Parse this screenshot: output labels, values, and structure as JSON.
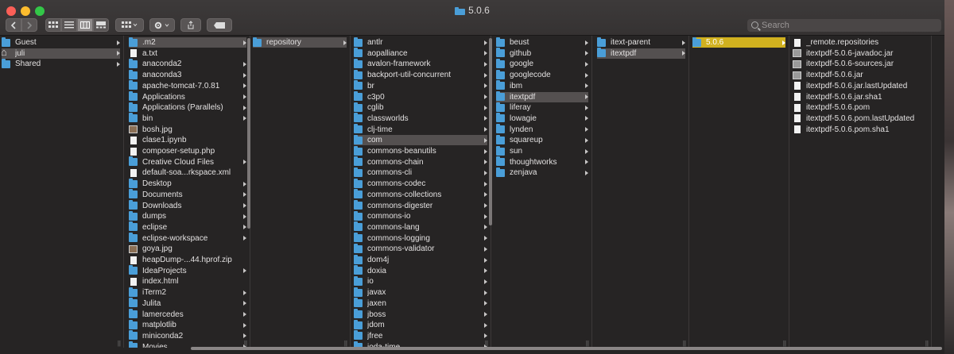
{
  "window": {
    "title": "5.0.6"
  },
  "toolbar": {
    "back_icon": "chevron-left-icon",
    "forward_icon": "chevron-right-icon",
    "view_icon_view": "grid-icon",
    "view_list": "list-icon",
    "view_columns": "columns-icon",
    "view_gallery": "gallery-icon",
    "arrange_icon": "arrange-icon",
    "action_icon": "gear-icon",
    "share_icon": "share-icon",
    "tags_icon": "tag-icon",
    "search_placeholder": "Search"
  },
  "columns": [
    {
      "items": [
        {
          "label": "Guest",
          "kind": "folder",
          "arrow": true
        },
        {
          "label": "juli",
          "kind": "home",
          "arrow": true,
          "selected": true
        },
        {
          "label": "Shared",
          "kind": "folder",
          "arrow": true
        }
      ]
    },
    {
      "items": [
        {
          "label": ".m2",
          "kind": "folder",
          "arrow": true,
          "selected": true
        },
        {
          "label": "a.txt",
          "kind": "file"
        },
        {
          "label": "anaconda2",
          "kind": "folder",
          "arrow": true
        },
        {
          "label": "anaconda3",
          "kind": "folder",
          "arrow": true
        },
        {
          "label": "apache-tomcat-7.0.81",
          "kind": "folder",
          "arrow": true
        },
        {
          "label": "Applications",
          "kind": "folder",
          "arrow": true
        },
        {
          "label": "Applications (Parallels)",
          "kind": "folder",
          "arrow": true
        },
        {
          "label": "bin",
          "kind": "folder",
          "arrow": true
        },
        {
          "label": "bosh.jpg",
          "kind": "image"
        },
        {
          "label": "clase1.ipynb",
          "kind": "file"
        },
        {
          "label": "composer-setup.php",
          "kind": "file"
        },
        {
          "label": "Creative Cloud Files",
          "kind": "folder",
          "arrow": true
        },
        {
          "label": "default-soa...rkspace.xml",
          "kind": "file"
        },
        {
          "label": "Desktop",
          "kind": "folder",
          "arrow": true
        },
        {
          "label": "Documents",
          "kind": "folder",
          "arrow": true
        },
        {
          "label": "Downloads",
          "kind": "folder",
          "arrow": true
        },
        {
          "label": "dumps",
          "kind": "folder",
          "arrow": true
        },
        {
          "label": "eclipse",
          "kind": "folder",
          "arrow": true
        },
        {
          "label": "eclipse-workspace",
          "kind": "folder",
          "arrow": true
        },
        {
          "label": "goya.jpg",
          "kind": "image"
        },
        {
          "label": "heapDump-...44.hprof.zip",
          "kind": "file"
        },
        {
          "label": "IdeaProjects",
          "kind": "folder",
          "arrow": true
        },
        {
          "label": "index.html",
          "kind": "file"
        },
        {
          "label": "iTerm2",
          "kind": "folder",
          "arrow": true
        },
        {
          "label": "Julita",
          "kind": "folder",
          "arrow": true
        },
        {
          "label": "lamercedes",
          "kind": "folder",
          "arrow": true
        },
        {
          "label": "matplotlib",
          "kind": "folder",
          "arrow": true
        },
        {
          "label": "miniconda2",
          "kind": "folder",
          "arrow": true
        },
        {
          "label": "Movies",
          "kind": "folder",
          "arrow": true
        }
      ]
    },
    {
      "items": [
        {
          "label": "repository",
          "kind": "folder",
          "arrow": true,
          "selected": true
        }
      ]
    },
    {
      "items": [
        {
          "label": "antlr",
          "kind": "folder",
          "arrow": true
        },
        {
          "label": "aopalliance",
          "kind": "folder",
          "arrow": true
        },
        {
          "label": "avalon-framework",
          "kind": "folder",
          "arrow": true
        },
        {
          "label": "backport-util-concurrent",
          "kind": "folder",
          "arrow": true
        },
        {
          "label": "br",
          "kind": "folder",
          "arrow": true
        },
        {
          "label": "c3p0",
          "kind": "folder",
          "arrow": true
        },
        {
          "label": "cglib",
          "kind": "folder",
          "arrow": true
        },
        {
          "label": "classworlds",
          "kind": "folder",
          "arrow": true
        },
        {
          "label": "clj-time",
          "kind": "folder",
          "arrow": true
        },
        {
          "label": "com",
          "kind": "folder",
          "arrow": true,
          "selected": true
        },
        {
          "label": "commons-beanutils",
          "kind": "folder",
          "arrow": true
        },
        {
          "label": "commons-chain",
          "kind": "folder",
          "arrow": true
        },
        {
          "label": "commons-cli",
          "kind": "folder",
          "arrow": true
        },
        {
          "label": "commons-codec",
          "kind": "folder",
          "arrow": true
        },
        {
          "label": "commons-collections",
          "kind": "folder",
          "arrow": true
        },
        {
          "label": "commons-digester",
          "kind": "folder",
          "arrow": true
        },
        {
          "label": "commons-io",
          "kind": "folder",
          "arrow": true
        },
        {
          "label": "commons-lang",
          "kind": "folder",
          "arrow": true
        },
        {
          "label": "commons-logging",
          "kind": "folder",
          "arrow": true
        },
        {
          "label": "commons-validator",
          "kind": "folder",
          "arrow": true
        },
        {
          "label": "dom4j",
          "kind": "folder",
          "arrow": true
        },
        {
          "label": "doxia",
          "kind": "folder",
          "arrow": true
        },
        {
          "label": "io",
          "kind": "folder",
          "arrow": true
        },
        {
          "label": "javax",
          "kind": "folder",
          "arrow": true
        },
        {
          "label": "jaxen",
          "kind": "folder",
          "arrow": true
        },
        {
          "label": "jboss",
          "kind": "folder",
          "arrow": true
        },
        {
          "label": "jdom",
          "kind": "folder",
          "arrow": true
        },
        {
          "label": "jfree",
          "kind": "folder",
          "arrow": true
        },
        {
          "label": "joda-time",
          "kind": "folder",
          "arrow": true
        }
      ]
    },
    {
      "items": [
        {
          "label": "beust",
          "kind": "folder",
          "arrow": true
        },
        {
          "label": "github",
          "kind": "folder",
          "arrow": true
        },
        {
          "label": "google",
          "kind": "folder",
          "arrow": true
        },
        {
          "label": "googlecode",
          "kind": "folder",
          "arrow": true
        },
        {
          "label": "ibm",
          "kind": "folder",
          "arrow": true
        },
        {
          "label": "itextpdf",
          "kind": "folder",
          "arrow": true,
          "selected": true
        },
        {
          "label": "liferay",
          "kind": "folder",
          "arrow": true
        },
        {
          "label": "lowagie",
          "kind": "folder",
          "arrow": true
        },
        {
          "label": "lynden",
          "kind": "folder",
          "arrow": true
        },
        {
          "label": "squareup",
          "kind": "folder",
          "arrow": true
        },
        {
          "label": "sun",
          "kind": "folder",
          "arrow": true
        },
        {
          "label": "thoughtworks",
          "kind": "folder",
          "arrow": true
        },
        {
          "label": "zenjava",
          "kind": "folder",
          "arrow": true
        }
      ]
    },
    {
      "items": [
        {
          "label": "itext-parent",
          "kind": "folder",
          "arrow": true
        },
        {
          "label": "itextpdf",
          "kind": "folder",
          "arrow": true,
          "selected": true
        }
      ]
    },
    {
      "items": [
        {
          "label": "5.0.6",
          "kind": "folder",
          "arrow": true,
          "selected": true,
          "active": true
        }
      ]
    },
    {
      "items": [
        {
          "label": "_remote.repositories",
          "kind": "file"
        },
        {
          "label": "itextpdf-5.0.6-javadoc.jar",
          "kind": "jar"
        },
        {
          "label": "itextpdf-5.0.6-sources.jar",
          "kind": "jar"
        },
        {
          "label": "itextpdf-5.0.6.jar",
          "kind": "jar"
        },
        {
          "label": "itextpdf-5.0.6.jar.lastUpdated",
          "kind": "file"
        },
        {
          "label": "itextpdf-5.0.6.jar.sha1",
          "kind": "file"
        },
        {
          "label": "itextpdf-5.0.6.pom",
          "kind": "file"
        },
        {
          "label": "itextpdf-5.0.6.pom.lastUpdated",
          "kind": "file"
        },
        {
          "label": "itextpdf-5.0.6.pom.sha1",
          "kind": "file"
        }
      ]
    }
  ]
}
